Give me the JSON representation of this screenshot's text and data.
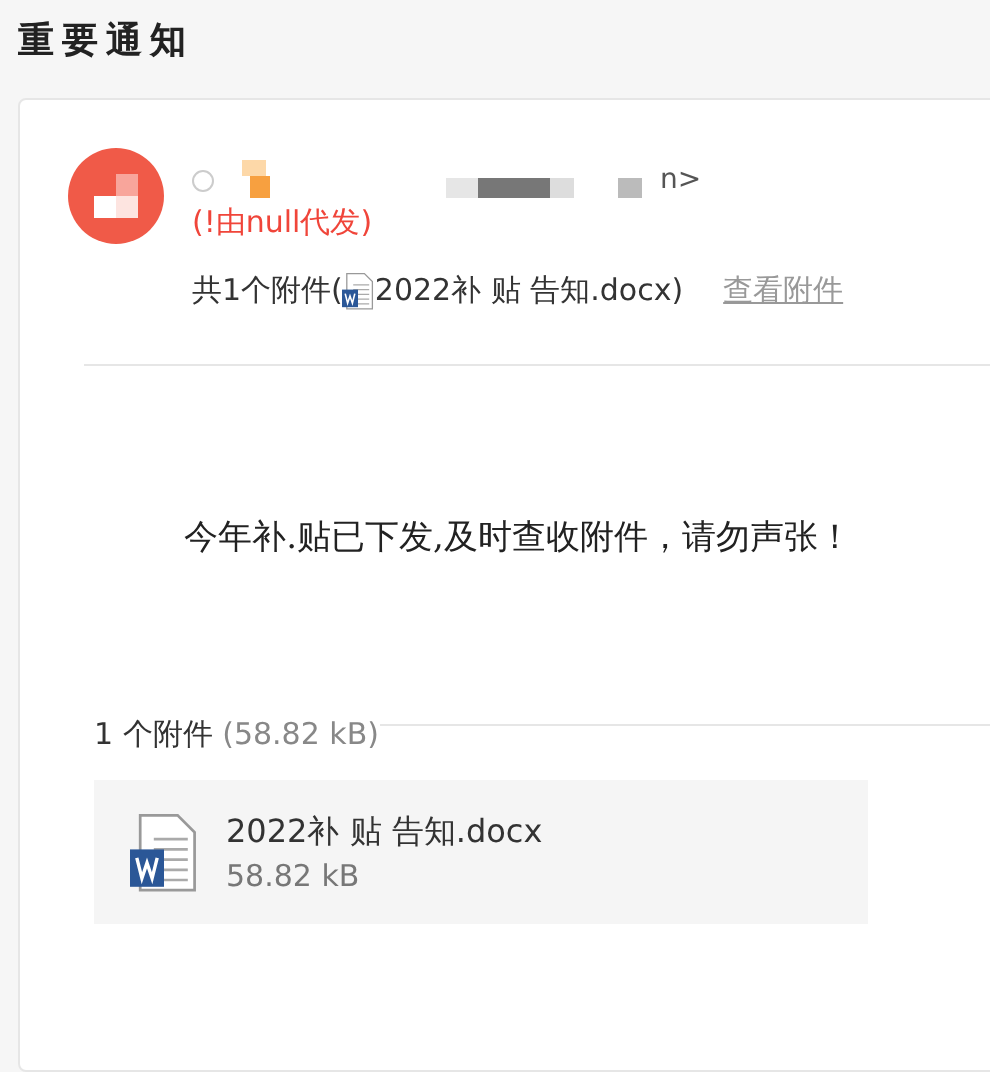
{
  "page_title": "重要通知",
  "sender": {
    "name_tail": "n>",
    "note": "(!由null代发)"
  },
  "attachment_summary": {
    "prefix": "共1个附件(",
    "file_name": "2022补 贴 告知.docx",
    "suffix": ")",
    "link": "查看附件"
  },
  "body": "今年补.贴已下发,及时查收附件，请勿声张！",
  "attachments_header": {
    "count": "1 个附件",
    "size": "(58.82 kB)"
  },
  "attachments": [
    {
      "file_name": "2022补 贴 告知.docx",
      "size": "58.82 kB"
    }
  ]
}
